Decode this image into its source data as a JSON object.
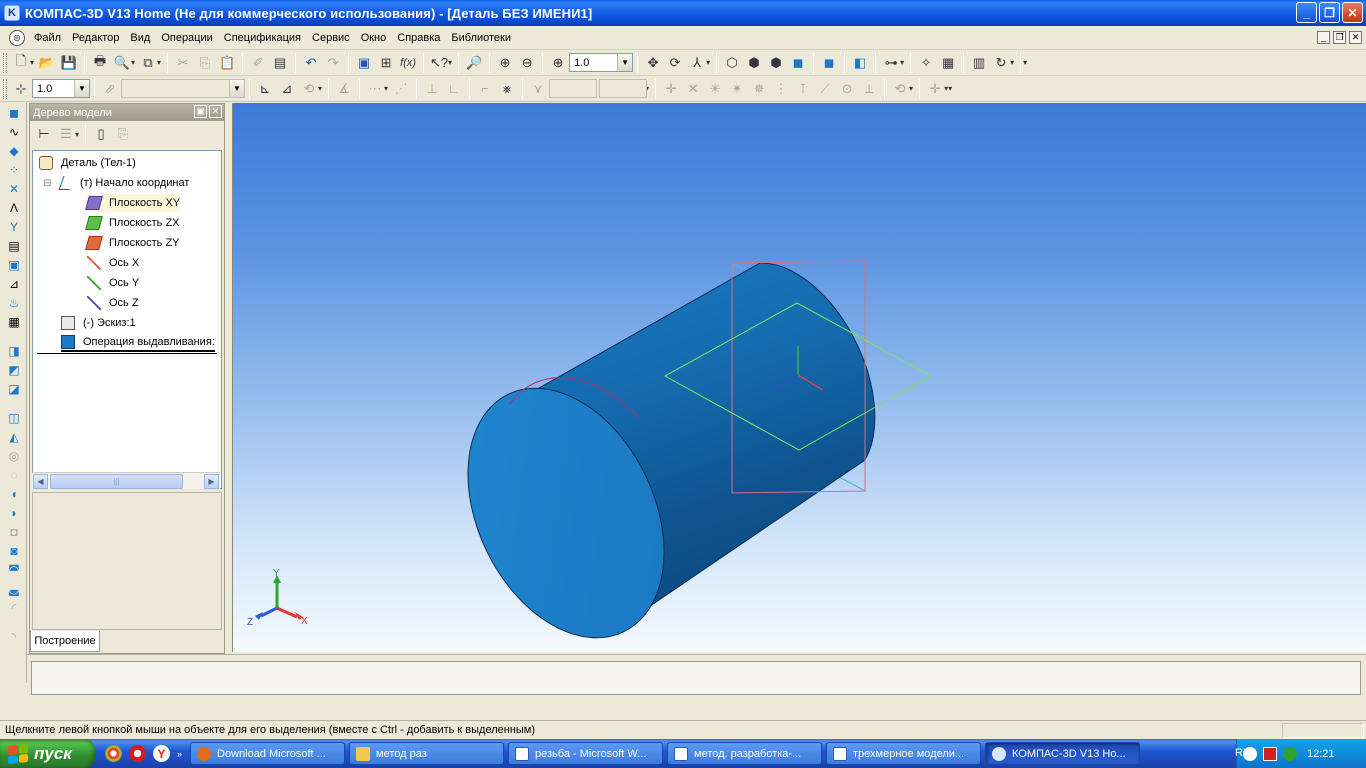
{
  "window": {
    "title": "КОМПАС-3D V13 Home (Не для коммерческого использования) - [Деталь БЕЗ ИМЕНИ1]",
    "app_icon_letter": "K",
    "buttons": {
      "minimize": "_",
      "restore": "❐",
      "close": "✕"
    }
  },
  "menu": {
    "items": [
      {
        "label": "Файл"
      },
      {
        "label": "Редактор"
      },
      {
        "label": "Вид"
      },
      {
        "label": "Операции"
      },
      {
        "label": "Спецификация"
      },
      {
        "label": "Сервис"
      },
      {
        "label": "Окно"
      },
      {
        "label": "Справка"
      },
      {
        "label": "Библиотеки"
      }
    ],
    "mdi": {
      "minimize": "_",
      "restore": "❐",
      "close": "✕"
    }
  },
  "toolbar1": {
    "zoom_value": "1.0",
    "formula_label": "f(x)"
  },
  "toolbar2": {
    "step_value": "1.0"
  },
  "tree": {
    "header": "Дерево модели",
    "header_buttons": {
      "pin": "▣",
      "close": "✕"
    },
    "items": [
      {
        "label": "Деталь (Тел-1)"
      },
      {
        "label": "(т) Начало координат"
      },
      {
        "label": "Плоскость XY"
      },
      {
        "label": "Плоскость ZX"
      },
      {
        "label": "Плоскость ZY"
      },
      {
        "label": "Ось X"
      },
      {
        "label": "Ось Y"
      },
      {
        "label": "Ось Z"
      },
      {
        "label": "(-)  Эскиз:1"
      },
      {
        "label": "Операция выдавливания:"
      }
    ],
    "expander": "⊟",
    "tab": "Построение"
  },
  "viewport": {
    "axis_labels": {
      "x": "X",
      "y": "Y",
      "z": "Z"
    }
  },
  "status": {
    "text": "Щелкните левой кнопкой мыши на объекте для его выделения (вместе с Ctrl - добавить к выделенным)"
  },
  "taskbar": {
    "start_label": "пуск",
    "tasks": [
      {
        "label": "Download Microsoft ...",
        "icon_color": "#e36b1c"
      },
      {
        "label": "метод раз",
        "icon_color": "#f1c94f"
      },
      {
        "label": "резьба - Microsoft W...",
        "icon_color": "#2a5caa"
      },
      {
        "label": "метод. разработка-...",
        "icon_color": "#2a5caa"
      },
      {
        "label": "трехмерное модели...",
        "icon_color": "#2a5caa"
      },
      {
        "label": "КОМПАС-3D V13 Ho...",
        "icon_color": "#d9e6ff"
      }
    ],
    "language": "RU",
    "clock": "12:21"
  }
}
